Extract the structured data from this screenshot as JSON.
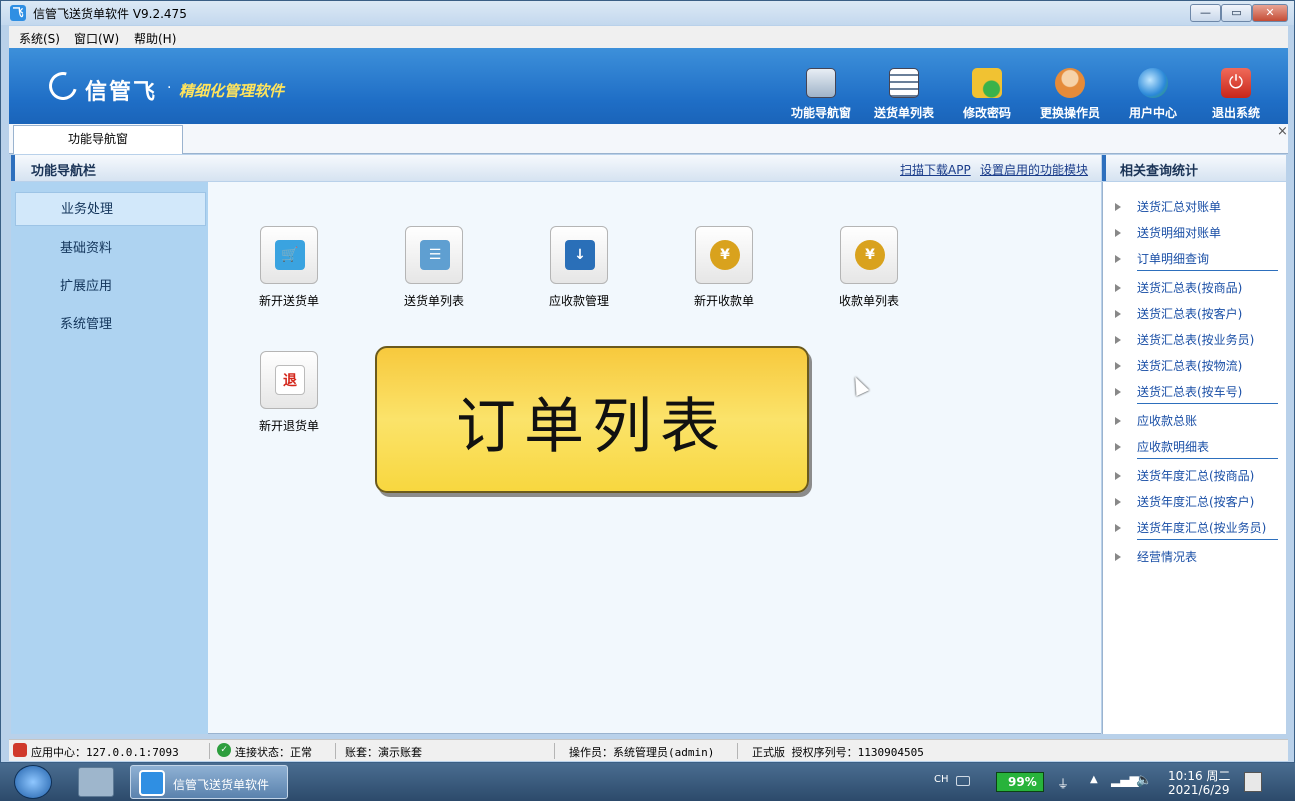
{
  "window": {
    "title": "信管飞送货单软件 V9.2.475",
    "title_icon": "app-logo-icon",
    "buttons": {
      "minimize": "—",
      "maximize": "▭",
      "close": "✕"
    }
  },
  "menubar": [
    "系统(S)",
    "窗口(W)",
    "帮助(H)"
  ],
  "banner": {
    "logo_text": "信管飞",
    "dot": "·",
    "slogan": "精细化管理软件",
    "toolbar": [
      {
        "label": "功能导航窗",
        "icon": "monitor-icon"
      },
      {
        "label": "送货单列表",
        "icon": "list-icon"
      },
      {
        "label": "修改密码",
        "icon": "lock-icon"
      },
      {
        "label": "更换操作员",
        "icon": "user-icon"
      },
      {
        "label": "用户中心",
        "icon": "globe-icon"
      },
      {
        "label": "退出系统",
        "icon": "power-icon"
      }
    ]
  },
  "tabs": [
    {
      "label": "功能导航窗"
    }
  ],
  "tab_close": "×",
  "left_panel": {
    "title": "功能导航栏",
    "items": [
      "业务处理",
      "基础资料",
      "扩展应用",
      "系统管理"
    ],
    "active_index": 0
  },
  "center": {
    "links": [
      "扫描下载APP",
      "设置启用的功能模块"
    ],
    "tiles": [
      {
        "label": "新开送货单",
        "icon": "cart-new-icon",
        "glyph": "🛒"
      },
      {
        "label": "送货单列表",
        "icon": "cart-list-icon",
        "glyph": "☰"
      },
      {
        "label": "应收款管理",
        "icon": "receivable-icon",
        "glyph": "↓"
      },
      {
        "label": "新开收款单",
        "icon": "yen-receipt-icon",
        "glyph": "¥"
      },
      {
        "label": "收款单列表",
        "icon": "yen-list-icon",
        "glyph": "¥"
      },
      {
        "label": "新开退货单",
        "icon": "return-icon",
        "glyph": "退"
      }
    ],
    "popup_text": "订单列表"
  },
  "right_panel": {
    "title": "相关查询统计",
    "items": [
      "送货汇总对账单",
      "送货明细对账单",
      "订单明细查询",
      "送货汇总表(按商品)",
      "送货汇总表(按客户)",
      "送货汇总表(按业务员)",
      "送货汇总表(按物流)",
      "送货汇总表(按车号)",
      "应收款总账",
      "应收款明细表",
      "送货年度汇总(按商品)",
      "送货年度汇总(按客户)",
      "送货年度汇总(按业务员)",
      "经营情况表"
    ]
  },
  "statusbar": {
    "app_center": "应用中心：127.0.0.1:7093",
    "connection": "连接状态：正常",
    "account": "账套：演示账套",
    "operator": "操作员：系统管理员(admin)",
    "license": "正式版 授权序列号：1130904505"
  },
  "taskbar": {
    "app_label": "信管飞送货单软件",
    "ime": "CH",
    "battery": "99%",
    "time": "10:16 周二",
    "date": "2021/6/29"
  },
  "colors": {
    "banner": "#2a7fd4",
    "nav_bg": "#aed3f1",
    "popup": "#f8d73f",
    "link": "#1a4fa6"
  }
}
